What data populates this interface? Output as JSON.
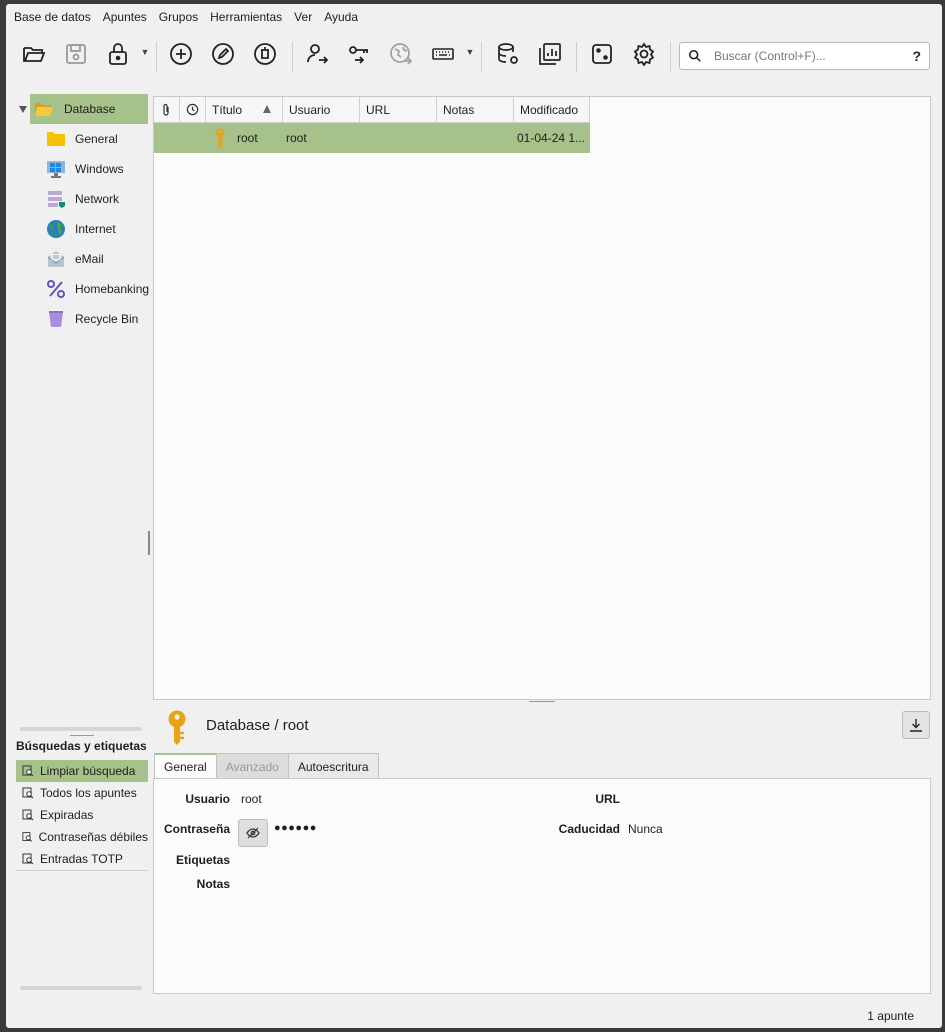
{
  "menu": [
    "Base de datos",
    "Apuntes",
    "Grupos",
    "Herramientas",
    "Ver",
    "Ayuda"
  ],
  "search": {
    "placeholder": "Buscar (Control+F)...",
    "help": "?"
  },
  "toolbar_icons": [
    "open-database-icon",
    "save-database-icon",
    "lock-icon",
    "add-entry-icon",
    "edit-entry-icon",
    "delete-entry-icon",
    "copy-username-icon",
    "copy-password-icon",
    "open-url-icon",
    "autotype-keyboard-icon",
    "database-settings-icon",
    "reports-icon",
    "password-generator-icon",
    "settings-icon"
  ],
  "tree": {
    "root": "Database",
    "groups": [
      "General",
      "Windows",
      "Network",
      "Internet",
      "eMail",
      "Homebanking",
      "Recycle Bin"
    ]
  },
  "table": {
    "columns": [
      "Título",
      "Usuario",
      "URL",
      "Notas",
      "Modificado"
    ],
    "rows": [
      {
        "title": "root",
        "username": "root",
        "url": "",
        "notes": "",
        "modified": "01-04-24 1..."
      }
    ]
  },
  "searches": {
    "title": "Búsquedas y etiquetas",
    "items": [
      "Limpiar búsqueda",
      "Todos los apuntes",
      "Expiradas",
      "Contraseñas débiles",
      "Entradas TOTP"
    ]
  },
  "details": {
    "title": "Database / root",
    "tabs": [
      "General",
      "Avanzado",
      "Autoescritura"
    ],
    "labels": {
      "username": "Usuario",
      "password": "Contraseña",
      "tags": "Etiquetas",
      "notes": "Notas",
      "url": "URL",
      "expiry": "Caducidad"
    },
    "values": {
      "username": "root",
      "password": "●●●●●●",
      "expiry": "Nunca"
    }
  },
  "status": "1 apunte",
  "colors": {
    "selection": "#a6c18a",
    "key": "#e8a317"
  }
}
